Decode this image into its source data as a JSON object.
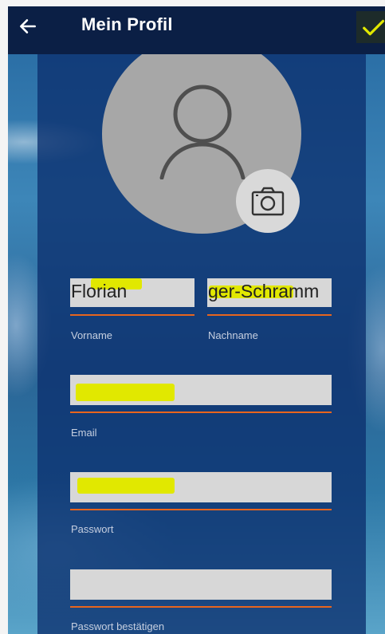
{
  "header": {
    "title": "Mein Profil"
  },
  "form": {
    "first_name": {
      "value": "Florian",
      "label": "Vorname"
    },
    "last_name": {
      "value": "ger-Schramm",
      "label": "Nachname"
    },
    "email": {
      "label": "Email"
    },
    "password": {
      "label": "Passwort"
    },
    "password_confirm": {
      "label": "Passwort bestätigen"
    }
  },
  "colors": {
    "header_bg": "#0b1f45",
    "panel_bg": "#0c306e",
    "accent_underline": "#e8651d",
    "highlight": "#e1e800",
    "field_bg": "#d7d7d7",
    "avatar_bg": "#a7a7a7"
  },
  "icons": {
    "back": "arrow-left-icon",
    "confirm": "checkmark-icon",
    "avatar": "person-icon",
    "camera": "camera-icon"
  }
}
